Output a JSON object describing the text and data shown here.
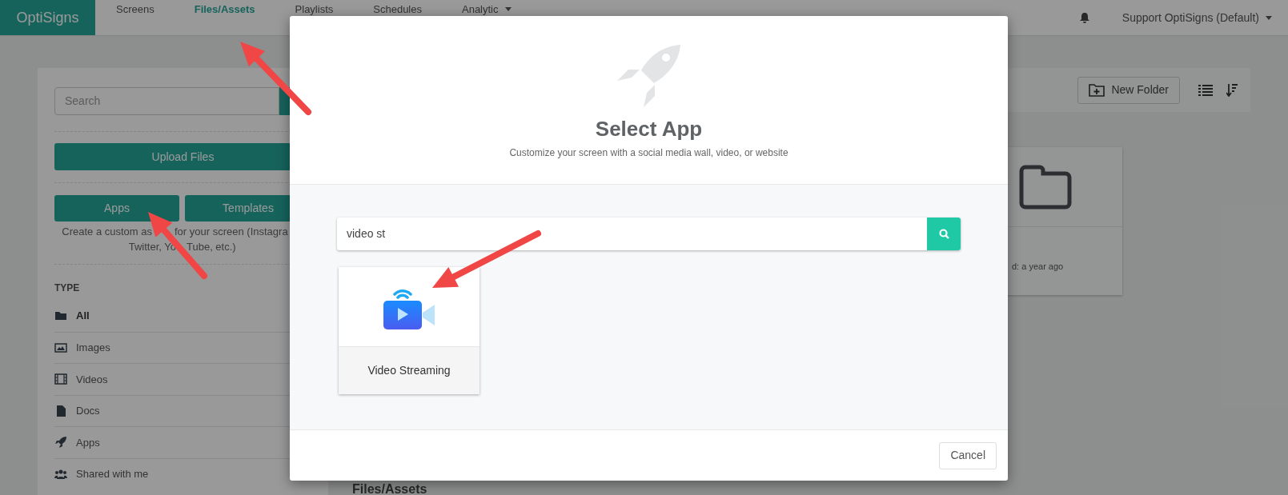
{
  "nav": {
    "brand": "OptiSigns",
    "items": [
      {
        "label": "Screens",
        "selected": false
      },
      {
        "label": "Files/Assets",
        "selected": true
      },
      {
        "label": "Playlists",
        "selected": false
      },
      {
        "label": "Schedules",
        "selected": false
      },
      {
        "label": "Analytic",
        "selected": false,
        "dropdown": true
      }
    ],
    "account": "Support OptiSigns (Default)"
  },
  "sidebar": {
    "search_placeholder": "Search",
    "upload_button": "Upload Files",
    "app_buttons": [
      "Apps",
      "Templates"
    ],
    "description": [
      [
        "Create a custom as",
        "for your screen (Instagra"
      ],
      [
        "Twitter, Yo",
        "Tube, etc.)"
      ]
    ],
    "type_heading": "TYPE",
    "types": [
      {
        "label": "All",
        "kind": "folder",
        "selected": true
      },
      {
        "label": "Images",
        "kind": "image",
        "selected": false
      },
      {
        "label": "Videos",
        "kind": "film",
        "selected": false
      },
      {
        "label": "Docs",
        "kind": "doc",
        "selected": false
      },
      {
        "label": "Apps",
        "kind": "rocket",
        "selected": false
      },
      {
        "label": "Shared with me",
        "kind": "users",
        "selected": false
      }
    ]
  },
  "toolbar": {
    "new_folder": "New Folder"
  },
  "folder_card": {
    "meta": "d: a year ago"
  },
  "page_heading": "Files/Assets",
  "modal": {
    "title": "Select App",
    "subtitle": "Customize your screen with a social media wall, video, or website",
    "search_value": "video st",
    "results": [
      {
        "name": "Video Streaming"
      }
    ],
    "cancel": "Cancel"
  }
}
